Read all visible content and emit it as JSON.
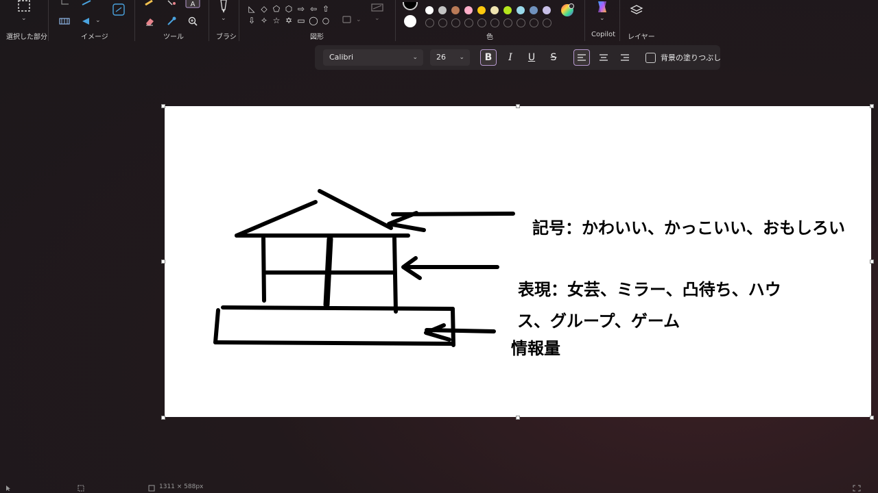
{
  "ribbon": {
    "groups": {
      "selection": "選択した部分",
      "image": "イメージ",
      "tools": "ツール",
      "brush": "ブラシ",
      "shapes": "図形",
      "color": "色",
      "copilot": "Copilot",
      "layers": "レイヤー"
    },
    "palette_colors": [
      "#ffffff",
      "#c3c3c3",
      "#b97a57",
      "#ffaec9",
      "#ffc90e",
      "#efe4b0",
      "#b5e61d",
      "#99d9ea",
      "#7092be",
      "#c8bfe7"
    ],
    "primary_color": "#000000",
    "secondary_color": "#ffffff"
  },
  "text_toolbar": {
    "font_family": "Calibri",
    "font_size": "26",
    "bold": "B",
    "italic": "I",
    "underline": "U",
    "strikethrough": "S",
    "fill_background_label": "背景の塗りつぶし"
  },
  "canvas": {
    "texts": {
      "line1": "記号：かわいい、かっこいい、おもしろい",
      "line2": "表現：女芸、ミラー、凸待ち、ハウ",
      "line3": "ス、グループ、ゲーム",
      "line4": "情報量"
    }
  },
  "status": {
    "dimensions": "1311 × 588px"
  }
}
